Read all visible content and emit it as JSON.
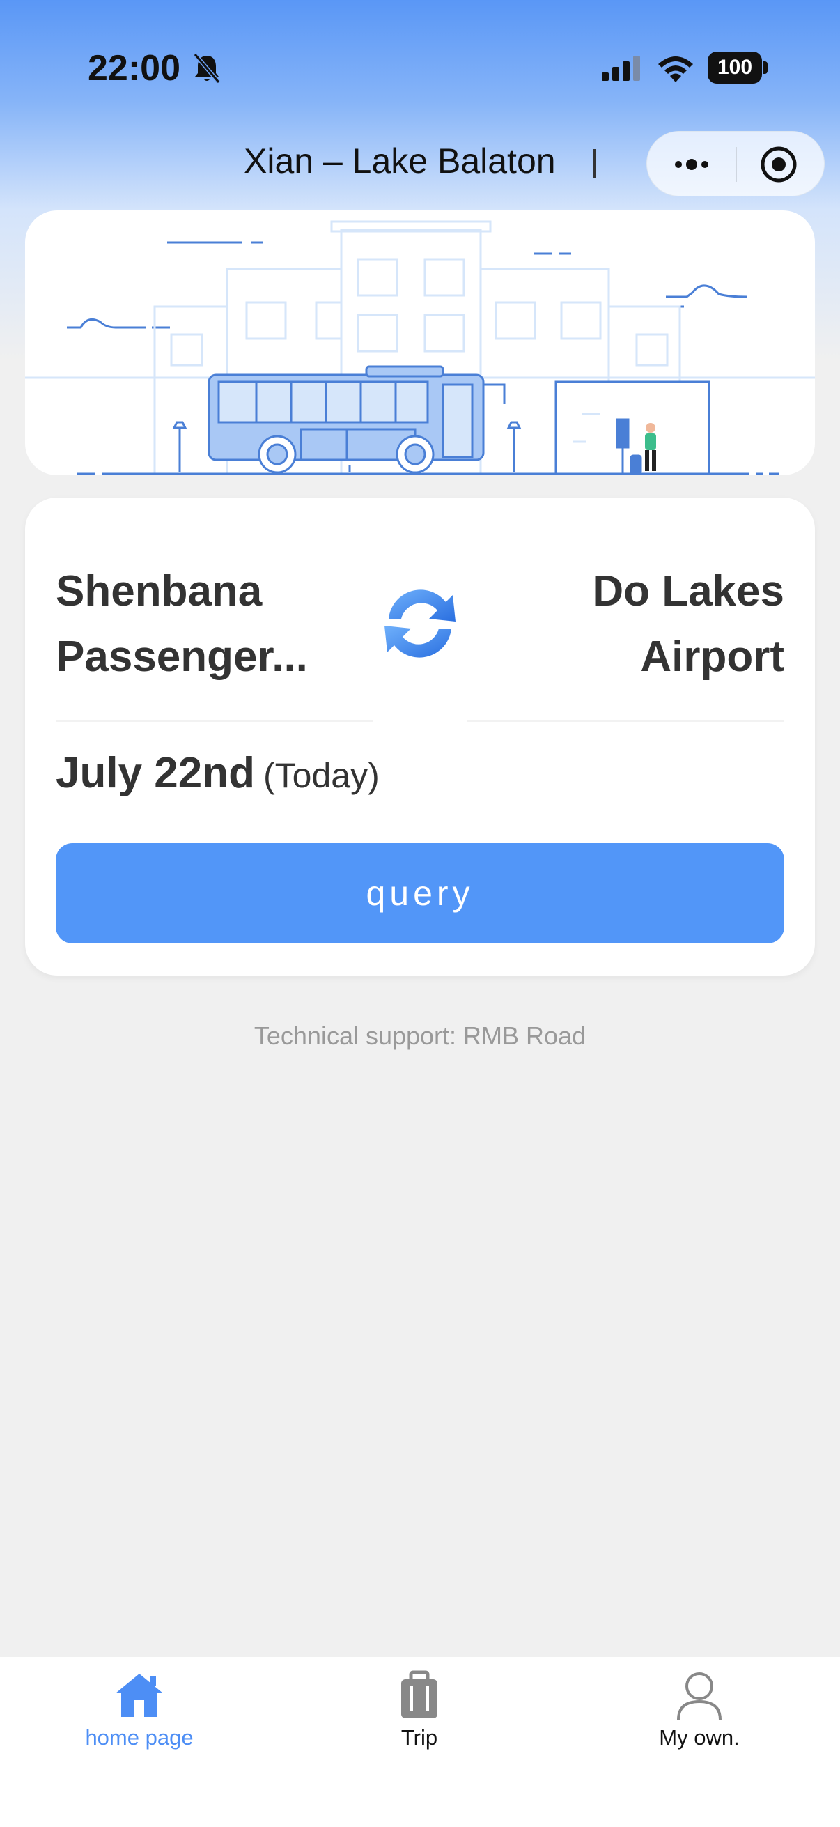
{
  "status_bar": {
    "time": "22:00",
    "battery": "100",
    "icons": [
      "bell-slash-icon",
      "cellular-signal-icon",
      "wifi-icon",
      "battery-icon"
    ]
  },
  "nav": {
    "title": "Xian – Lake Balaton",
    "capsule_icons": [
      "more-icon",
      "close-miniprogram-icon"
    ]
  },
  "banner": {
    "illustration": "bus-station-illustration",
    "colors": {
      "line": "#4a7fd6",
      "fill": "#a9c8f5",
      "light": "#d6e6fa"
    }
  },
  "query": {
    "from": "Shenbana Passenger...",
    "to": "Do Lakes Airport",
    "swap_icon": "swap-refresh-icon",
    "date": "July 22nd",
    "date_note": "(Today)",
    "button_label": "query"
  },
  "footer": {
    "support": "Technical support: RMB Road"
  },
  "tabbar": {
    "items": [
      {
        "label": "home page",
        "icon": "home-icon",
        "active": true
      },
      {
        "label": "Trip",
        "icon": "luggage-icon",
        "active": false
      },
      {
        "label": "My own.",
        "icon": "user-icon",
        "active": false
      }
    ],
    "active_color": "#4d8ef5"
  },
  "colors": {
    "accent": "#5296f8",
    "page_bg": "#f0f0f0",
    "header_top": "#5a97f6"
  }
}
